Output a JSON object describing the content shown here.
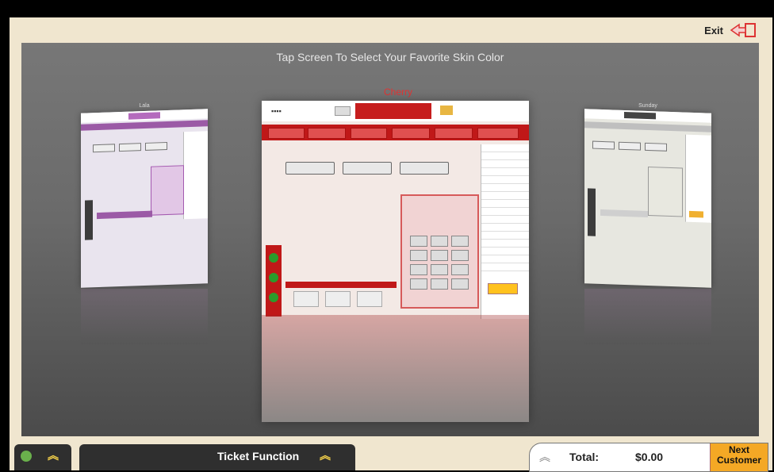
{
  "header": {
    "exit_label": "Exit",
    "exit_icon": "exit-arrow-icon"
  },
  "stage": {
    "prompt": "Tap Screen To Select Your Favorite Skin Color",
    "skins": [
      {
        "name": "Lala"
      },
      {
        "name": "Cherry"
      },
      {
        "name": "Sunday"
      }
    ]
  },
  "bottom_bar": {
    "ticket_function_label": "Ticket Function",
    "total_label": "Total:",
    "total_value": "$0.00",
    "next_label": "Next Customer"
  },
  "colors": {
    "cherry_red": "#c01818",
    "accent_yellow": "#f4a825",
    "stage_gray": "#6a6a6a",
    "frame_beige": "#f0e6cf"
  }
}
